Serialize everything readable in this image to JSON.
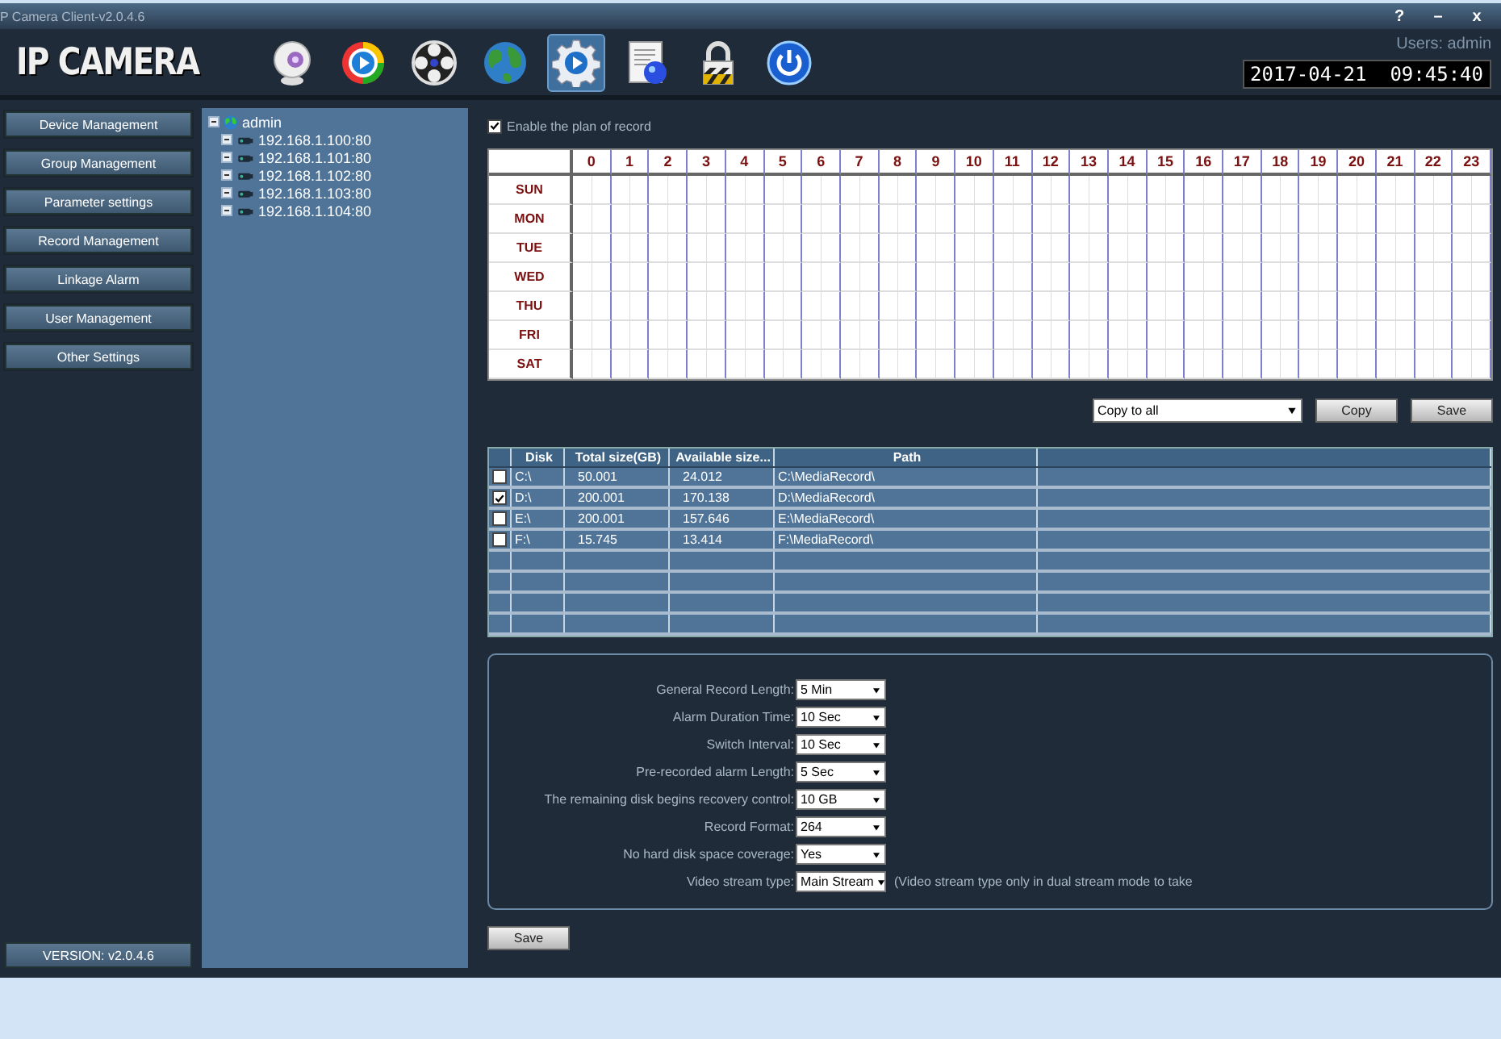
{
  "window": {
    "title": "P Camera Client-v2.0.4.6",
    "controls": [
      "?",
      "–",
      "x"
    ]
  },
  "header": {
    "logo": "IP CAMERA",
    "user": "Users: admin",
    "datetime": "2017-04-21  09:45:40"
  },
  "toolbar": [
    {
      "kind": "webcam",
      "selected": false
    },
    {
      "kind": "play",
      "selected": false
    },
    {
      "kind": "reel",
      "selected": false
    },
    {
      "kind": "globe",
      "selected": false
    },
    {
      "kind": "gear",
      "selected": true
    },
    {
      "kind": "document",
      "selected": false
    },
    {
      "kind": "lock",
      "selected": false
    },
    {
      "kind": "power",
      "selected": false
    }
  ],
  "sidebar": {
    "items": [
      "Device Management",
      "Group Management",
      "Parameter settings",
      "Record Management",
      "Linkage Alarm",
      "User Management",
      "Other Settings"
    ],
    "version": "VERSION: v2.0.4.6"
  },
  "tree": {
    "label": "admin",
    "expanded": true,
    "children": [
      {
        "label": "192.168.1.100:80"
      },
      {
        "label": "192.168.1.101:80"
      },
      {
        "label": "192.168.1.102:80"
      },
      {
        "label": "192.168.1.103:80"
      },
      {
        "label": "192.168.1.104:80"
      }
    ]
  },
  "schedule": {
    "enable_label": "Enable the plan of record",
    "enabled": true,
    "hours": [
      "0",
      "1",
      "2",
      "3",
      "4",
      "5",
      "6",
      "7",
      "8",
      "9",
      "10",
      "11",
      "12",
      "13",
      "14",
      "15",
      "16",
      "17",
      "18",
      "19",
      "20",
      "21",
      "22",
      "23"
    ],
    "days": [
      "SUN",
      "MON",
      "TUE",
      "WED",
      "THU",
      "FRI",
      "SAT"
    ],
    "copy_select": "Copy to all",
    "buttons": [
      "Copy",
      "Save"
    ]
  },
  "disks": {
    "columns": [
      "Disk",
      "Total size(GB)",
      "Available size...",
      "Path"
    ],
    "rows": [
      {
        "checked": false,
        "cells": [
          "C:\\",
          "50.001",
          "24.012",
          "C:\\MediaRecord\\"
        ]
      },
      {
        "checked": true,
        "cells": [
          "D:\\",
          "200.001",
          "170.138",
          "D:\\MediaRecord\\"
        ]
      },
      {
        "checked": false,
        "cells": [
          "E:\\",
          "200.001",
          "157.646",
          "E:\\MediaRecord\\"
        ]
      },
      {
        "checked": false,
        "cells": [
          "F:\\",
          "15.745",
          "13.414",
          "F:\\MediaRecord\\"
        ]
      }
    ]
  },
  "settings": [
    {
      "label": "General Record Length:",
      "value": "5 Min"
    },
    {
      "label": "Alarm Duration Time:",
      "value": "10 Sec"
    },
    {
      "label": "Switch Interval:",
      "value": "10 Sec"
    },
    {
      "label": "Pre-recorded alarm Length:",
      "value": "5 Sec"
    },
    {
      "label": "The remaining disk begins recovery control:",
      "value": "10 GB"
    },
    {
      "label": "Record Format:",
      "value": "264"
    },
    {
      "label": "No hard disk space coverage:",
      "value": "Yes"
    },
    {
      "label": "Video stream type:",
      "value": "Main Stream",
      "note": "(Video stream type only in dual stream mode to take"
    }
  ],
  "save_button": "Save"
}
